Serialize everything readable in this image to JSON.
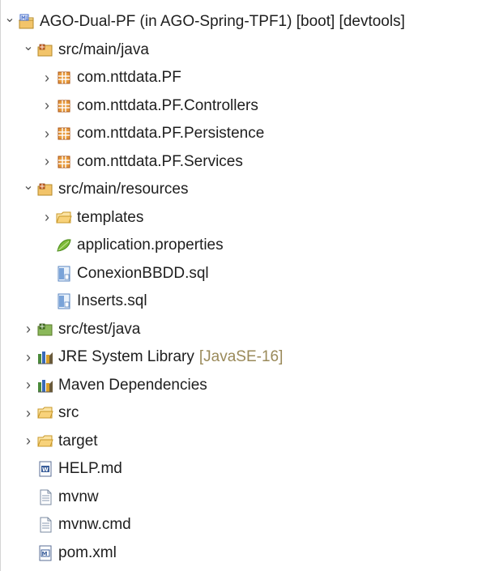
{
  "tree": {
    "items": [
      {
        "label": "AGO-Dual-PF (in AGO-Spring-TPF1) [boot] [devtools]",
        "depth": 0,
        "expanded": "open",
        "icon": "maven-project-icon",
        "decoration": ""
      },
      {
        "label": "src/main/java",
        "depth": 1,
        "expanded": "open",
        "icon": "source-folder-icon",
        "decoration": ""
      },
      {
        "label": "com.nttdata.PF",
        "depth": 2,
        "expanded": "closed",
        "icon": "package-icon",
        "decoration": ""
      },
      {
        "label": "com.nttdata.PF.Controllers",
        "depth": 2,
        "expanded": "closed",
        "icon": "package-icon",
        "decoration": ""
      },
      {
        "label": "com.nttdata.PF.Persistence",
        "depth": 2,
        "expanded": "closed",
        "icon": "package-icon",
        "decoration": ""
      },
      {
        "label": "com.nttdata.PF.Services",
        "depth": 2,
        "expanded": "closed",
        "icon": "package-icon",
        "decoration": ""
      },
      {
        "label": "src/main/resources",
        "depth": 1,
        "expanded": "open",
        "icon": "source-folder-icon",
        "decoration": ""
      },
      {
        "label": "templates",
        "depth": 2,
        "expanded": "closed",
        "icon": "folder-icon",
        "decoration": ""
      },
      {
        "label": "application.properties",
        "depth": 2,
        "expanded": "none",
        "icon": "spring-leaf-icon",
        "decoration": ""
      },
      {
        "label": "ConexionBBDD.sql",
        "depth": 2,
        "expanded": "none",
        "icon": "sql-file-icon",
        "decoration": ""
      },
      {
        "label": "Inserts.sql",
        "depth": 2,
        "expanded": "none",
        "icon": "sql-file-icon",
        "decoration": ""
      },
      {
        "label": "src/test/java",
        "depth": 1,
        "expanded": "closed",
        "icon": "test-source-folder-icon",
        "decoration": ""
      },
      {
        "label": "JRE System Library",
        "depth": 1,
        "expanded": "closed",
        "icon": "library-icon",
        "decoration": "[JavaSE-16]"
      },
      {
        "label": "Maven Dependencies",
        "depth": 1,
        "expanded": "closed",
        "icon": "library-icon",
        "decoration": ""
      },
      {
        "label": "src",
        "depth": 1,
        "expanded": "closed",
        "icon": "folder-icon",
        "decoration": ""
      },
      {
        "label": "target",
        "depth": 1,
        "expanded": "closed",
        "icon": "folder-icon",
        "decoration": ""
      },
      {
        "label": "HELP.md",
        "depth": 1,
        "expanded": "none",
        "icon": "markdown-file-icon",
        "decoration": ""
      },
      {
        "label": "mvnw",
        "depth": 1,
        "expanded": "none",
        "icon": "text-file-icon",
        "decoration": ""
      },
      {
        "label": "mvnw.cmd",
        "depth": 1,
        "expanded": "none",
        "icon": "text-file-icon",
        "decoration": ""
      },
      {
        "label": "pom.xml",
        "depth": 1,
        "expanded": "none",
        "icon": "pom-file-icon",
        "decoration": ""
      }
    ]
  },
  "colors": {
    "text": "#1e1e1e",
    "decoration": "#9a8a5a",
    "twisty": "#555555"
  }
}
